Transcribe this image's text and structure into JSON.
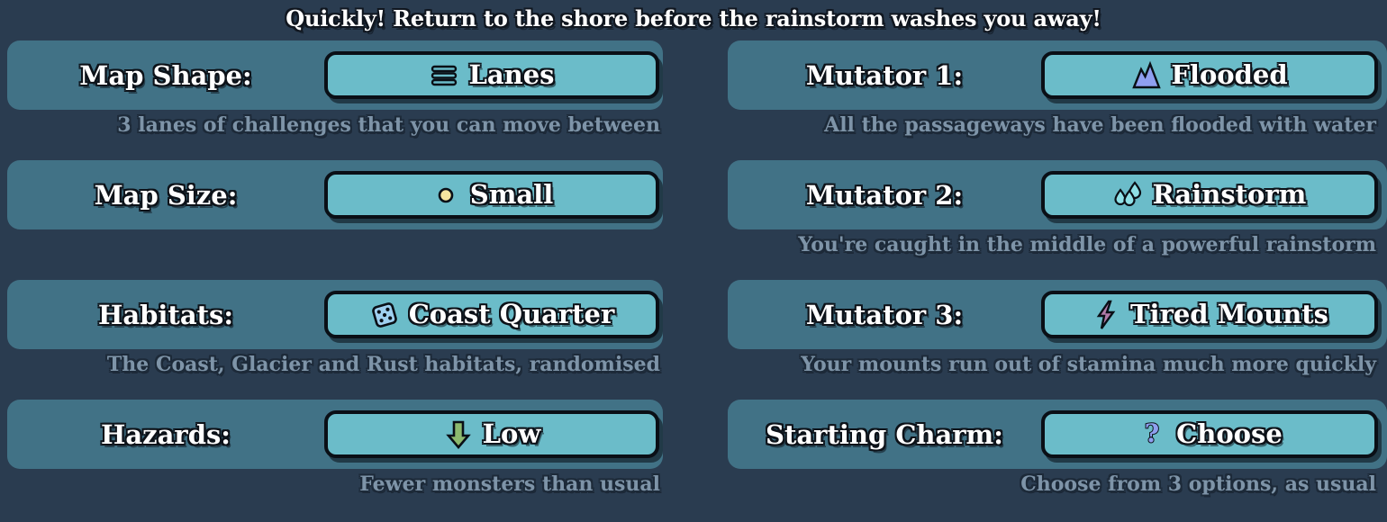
{
  "banner": {
    "text": "Quickly! Return to the shore before the rainstorm washes you away!"
  },
  "colors": {
    "background": "#2a3c50",
    "panel": "#417286",
    "button": "#6bbcc9",
    "button_border": "#0a0f16",
    "label_text": "#ffffff",
    "description_text": "#7e94a8"
  },
  "left_column": {
    "rows": [
      {
        "label": "Map Shape:",
        "value": "Lanes",
        "icon": "lanes-icon",
        "description": "3 lanes of challenges that you can move between"
      },
      {
        "label": "Map Size:",
        "value": "Small",
        "icon": "small-dot-icon",
        "description": ""
      },
      {
        "label": "Habitats:",
        "value": "Coast Quarter",
        "icon": "dice-icon",
        "description": "The Coast, Glacier and Rust habitats, randomised"
      },
      {
        "label": "Hazards:",
        "value": "Low",
        "icon": "down-arrow-icon",
        "description": "Fewer monsters than usual"
      }
    ]
  },
  "right_column": {
    "rows": [
      {
        "label": "Mutator 1:",
        "value": "Flooded",
        "icon": "mountain-icon",
        "description": "All the passageways have been flooded with water"
      },
      {
        "label": "Mutator 2:",
        "value": "Rainstorm",
        "icon": "raindrops-icon",
        "description": "You're caught in the middle of a powerful rainstorm"
      },
      {
        "label": "Mutator 3:",
        "value": "Tired Mounts",
        "icon": "lightning-bolt-icon",
        "description": "Your mounts run out of stamina much more quickly"
      },
      {
        "label": "Starting Charm:",
        "value": "Choose",
        "icon": "question-mark-icon",
        "description": "Choose from 3 options, as usual"
      }
    ]
  }
}
